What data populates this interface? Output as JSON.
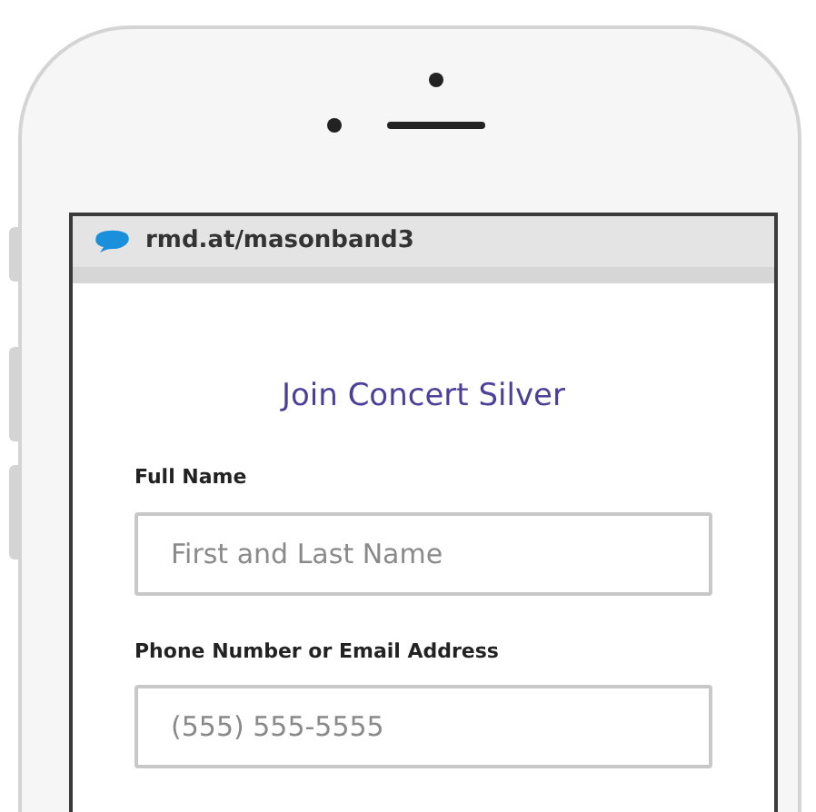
{
  "browser": {
    "url": "rmd.at/masonband3"
  },
  "form": {
    "title": "Join Concert Silver",
    "fields": [
      {
        "label": "Full Name",
        "placeholder": "First and Last Name"
      },
      {
        "label": "Phone Number or Email Address",
        "placeholder": "(555) 555-5555"
      }
    ]
  }
}
